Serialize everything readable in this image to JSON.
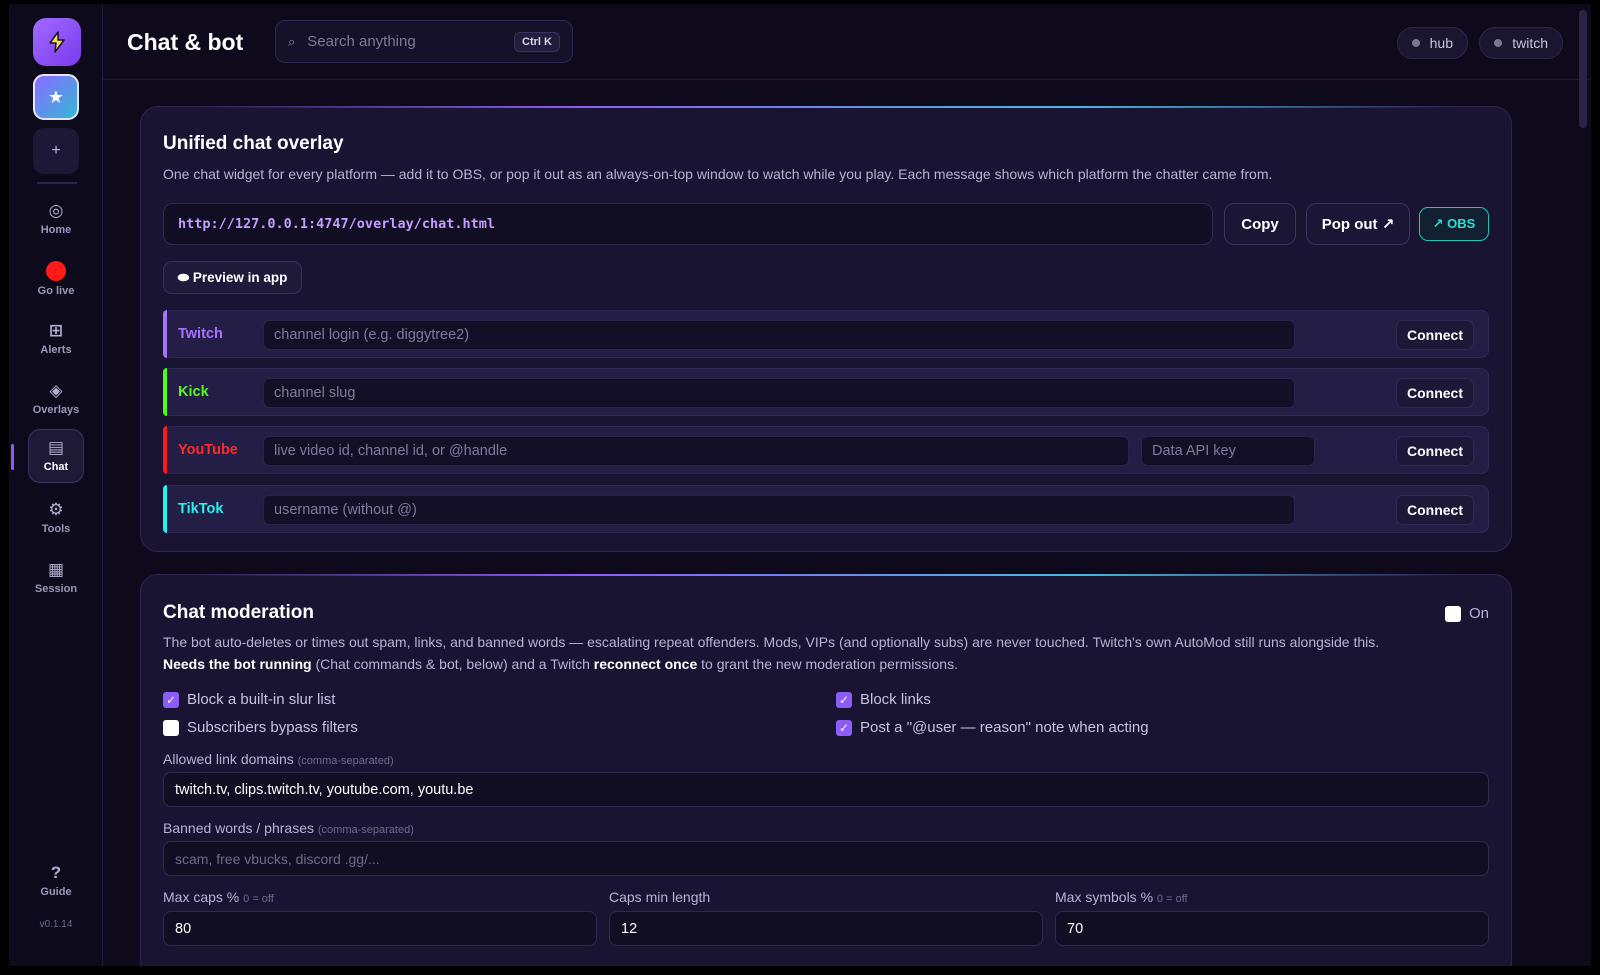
{
  "app": {
    "title": "Chat & bot",
    "version": "v0.1.14"
  },
  "search": {
    "placeholder": "Search anything",
    "shortcut": "Ctrl K"
  },
  "header_pills": [
    {
      "label": "hub"
    },
    {
      "label": "twitch"
    }
  ],
  "sidebar": {
    "items": [
      {
        "label": "Home",
        "icon": "home-icon"
      },
      {
        "label": "Go live",
        "icon": "record-dot-icon"
      },
      {
        "label": "Alerts",
        "icon": "grid-icon"
      },
      {
        "label": "Overlays",
        "icon": "diamond-icon"
      },
      {
        "label": "Chat",
        "icon": "chat-list-icon",
        "active": true
      },
      {
        "label": "Tools",
        "icon": "gear-icon"
      },
      {
        "label": "Session",
        "icon": "calendar-icon"
      }
    ],
    "guide": {
      "label": "Guide",
      "icon": "question-icon"
    }
  },
  "overlay_card": {
    "title": "Unified chat overlay",
    "description": "One chat widget for every platform — add it to OBS, or pop it out as an always-on-top window to watch while you play. Each message shows which platform the chatter came from.",
    "url": "http://127.0.0.1:4747/overlay/chat.html",
    "copy_label": "Copy",
    "popout_label": "Pop out ↗",
    "obs_label": "↗ OBS",
    "preview_label": "⬬ Preview in app",
    "platforms": [
      {
        "name": "Twitch",
        "color": "#a970ff",
        "placeholder": "channel login (e.g. diggytree2)",
        "connect": "Connect"
      },
      {
        "name": "Kick",
        "color": "#53fc18",
        "placeholder": "channel slug",
        "connect": "Connect"
      },
      {
        "name": "YouTube",
        "color": "#ff1a1a",
        "placeholder": "live video id, channel id, or @handle",
        "api_placeholder": "Data API key",
        "connect": "Connect"
      },
      {
        "name": "TikTok",
        "color": "#25f4ee",
        "placeholder": "username (without @)",
        "connect": "Connect"
      }
    ]
  },
  "moderation_card": {
    "title": "Chat moderation",
    "toggle_label": "On",
    "toggle_on": false,
    "desc_line1": "The bot auto-deletes or times out spam, links, and banned words — escalating repeat offenders. Mods, VIPs (and optionally subs) are never touched. Twitch's own AutoMod still runs alongside this.",
    "desc_bold1": "Needs the bot running",
    "desc_mid": " (Chat commands & bot, below) and a Twitch ",
    "desc_bold2": "reconnect once",
    "desc_end": " to grant the new moderation permissions.",
    "checks": [
      {
        "label": "Block a built-in slur list",
        "checked": true
      },
      {
        "label": "Block links",
        "checked": true
      },
      {
        "label": "Subscribers bypass filters",
        "checked": false
      },
      {
        "label": "Post a \"@user — reason\" note when acting",
        "checked": true
      }
    ],
    "allowed_domains": {
      "label": "Allowed link domains",
      "hint": "(comma-separated)",
      "value": "twitch.tv, clips.twitch.tv, youtube.com, youtu.be"
    },
    "banned_words": {
      "label": "Banned words / phrases",
      "hint": "(comma-separated)",
      "placeholder": "scam, free vbucks, discord .gg/..."
    },
    "max_caps": {
      "label": "Max caps %",
      "hint": "0 = off",
      "value": "80"
    },
    "caps_min_length": {
      "label": "Caps min length",
      "value": "12"
    },
    "max_symbols": {
      "label": "Max symbols %",
      "hint": "0 = off",
      "value": "70"
    }
  },
  "colors": {
    "accent": "#8b5cf6",
    "background": "#0e0a1c",
    "card": "#1a1433"
  }
}
